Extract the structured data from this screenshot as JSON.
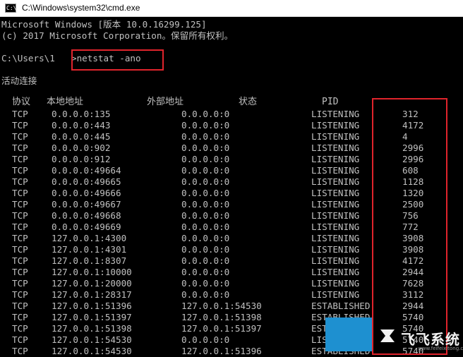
{
  "window": {
    "title": "C:\\Windows\\system32\\cmd.exe",
    "icon": "cmd-icon",
    "icon_glyph": "C:\\"
  },
  "console": {
    "version_line": "Microsoft Windows [版本 10.0.16299.125]",
    "copyright_line": "(c) 2017 Microsoft Corporation。保留所有权利。",
    "prompt": "C:\\Users\\1",
    "command": ">netstat -ano",
    "section_title": "活动连接",
    "columns": [
      "协议",
      "本地地址",
      "外部地址",
      "状态",
      "PID"
    ],
    "rows": [
      [
        "TCP",
        "0.0.0.0:135",
        "0.0.0.0:0",
        "LISTENING",
        "312"
      ],
      [
        "TCP",
        "0.0.0.0:443",
        "0.0.0.0:0",
        "LISTENING",
        "4172"
      ],
      [
        "TCP",
        "0.0.0.0:445",
        "0.0.0.0:0",
        "LISTENING",
        "4"
      ],
      [
        "TCP",
        "0.0.0.0:902",
        "0.0.0.0:0",
        "LISTENING",
        "2996"
      ],
      [
        "TCP",
        "0.0.0.0:912",
        "0.0.0.0:0",
        "LISTENING",
        "2996"
      ],
      [
        "TCP",
        "0.0.0.0:49664",
        "0.0.0.0:0",
        "LISTENING",
        "608"
      ],
      [
        "TCP",
        "0.0.0.0:49665",
        "0.0.0.0:0",
        "LISTENING",
        "1128"
      ],
      [
        "TCP",
        "0.0.0.0:49666",
        "0.0.0.0:0",
        "LISTENING",
        "1320"
      ],
      [
        "TCP",
        "0.0.0.0:49667",
        "0.0.0.0:0",
        "LISTENING",
        "2500"
      ],
      [
        "TCP",
        "0.0.0.0:49668",
        "0.0.0.0:0",
        "LISTENING",
        "756"
      ],
      [
        "TCP",
        "0.0.0.0:49669",
        "0.0.0.0:0",
        "LISTENING",
        "772"
      ],
      [
        "TCP",
        "127.0.0.1:4300",
        "0.0.0.0:0",
        "LISTENING",
        "3908"
      ],
      [
        "TCP",
        "127.0.0.1:4301",
        "0.0.0.0:0",
        "LISTENING",
        "3908"
      ],
      [
        "TCP",
        "127.0.0.1:8307",
        "0.0.0.0:0",
        "LISTENING",
        "4172"
      ],
      [
        "TCP",
        "127.0.0.1:10000",
        "0.0.0.0:0",
        "LISTENING",
        "2944"
      ],
      [
        "TCP",
        "127.0.0.1:20000",
        "0.0.0.0:0",
        "LISTENING",
        "7628"
      ],
      [
        "TCP",
        "127.0.0.1:28317",
        "0.0.0.0:0",
        "LISTENING",
        "3112"
      ],
      [
        "TCP",
        "127.0.0.1:51396",
        "127.0.0.1:54530",
        "ESTABLISHED",
        "2944"
      ],
      [
        "TCP",
        "127.0.0.1:51397",
        "127.0.0.1:51398",
        "ESTABLISHED",
        "5740"
      ],
      [
        "TCP",
        "127.0.0.1:51398",
        "127.0.0.1:51397",
        "ESTABLISHED",
        "5740"
      ],
      [
        "TCP",
        "127.0.0.1:54530",
        "0.0.0.0:0",
        "LISTENING",
        "5740"
      ],
      [
        "TCP",
        "127.0.0.1:54530",
        "127.0.0.1:51396",
        "ESTABLISHED",
        "5740"
      ]
    ]
  },
  "watermark": {
    "text": "飞飞系统",
    "url": "www.feifeixitong.com"
  },
  "colors": {
    "console_bg": "#000000",
    "console_text": "#c0c0c0",
    "highlight_box": "#e0242c"
  }
}
